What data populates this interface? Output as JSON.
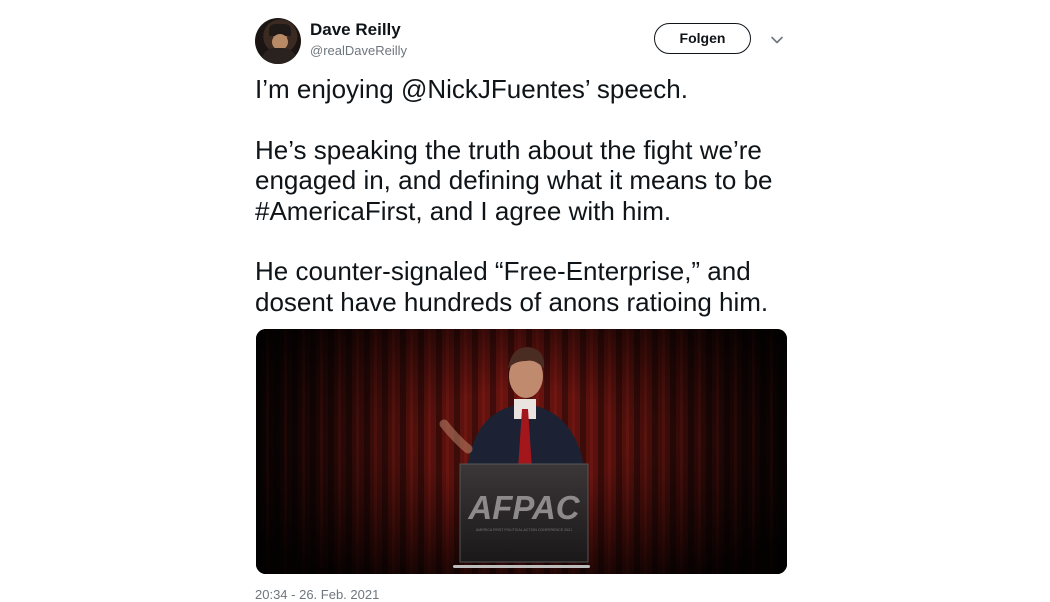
{
  "author": {
    "name": "Dave Reilly",
    "handle": "@realDaveReilly"
  },
  "follow_button": {
    "label": "Folgen"
  },
  "more_icon": "chevron-down-icon",
  "tweet": {
    "paragraphs": [
      "I’m enjoying @NickJFuentes’ speech.",
      "He’s speaking the truth about the fight we’re engaged in, and defining what it means to be #AmericaFirst, and I agree with him.",
      "He counter-signaled “Free-Enterprise,” and dosent have hundreds of anons ratioing him."
    ]
  },
  "media": {
    "podium_logo": "AFPAC",
    "podium_subtitle": "AMERICA FIRST POLITICAL ACTION CONFERENCE 2021",
    "progress": 0.5
  },
  "timestamp": "20:34 - 26. Feb. 2021",
  "colors": {
    "text": "#0f1419",
    "secondary": "#6e767d",
    "curtain": "#6b1410"
  }
}
